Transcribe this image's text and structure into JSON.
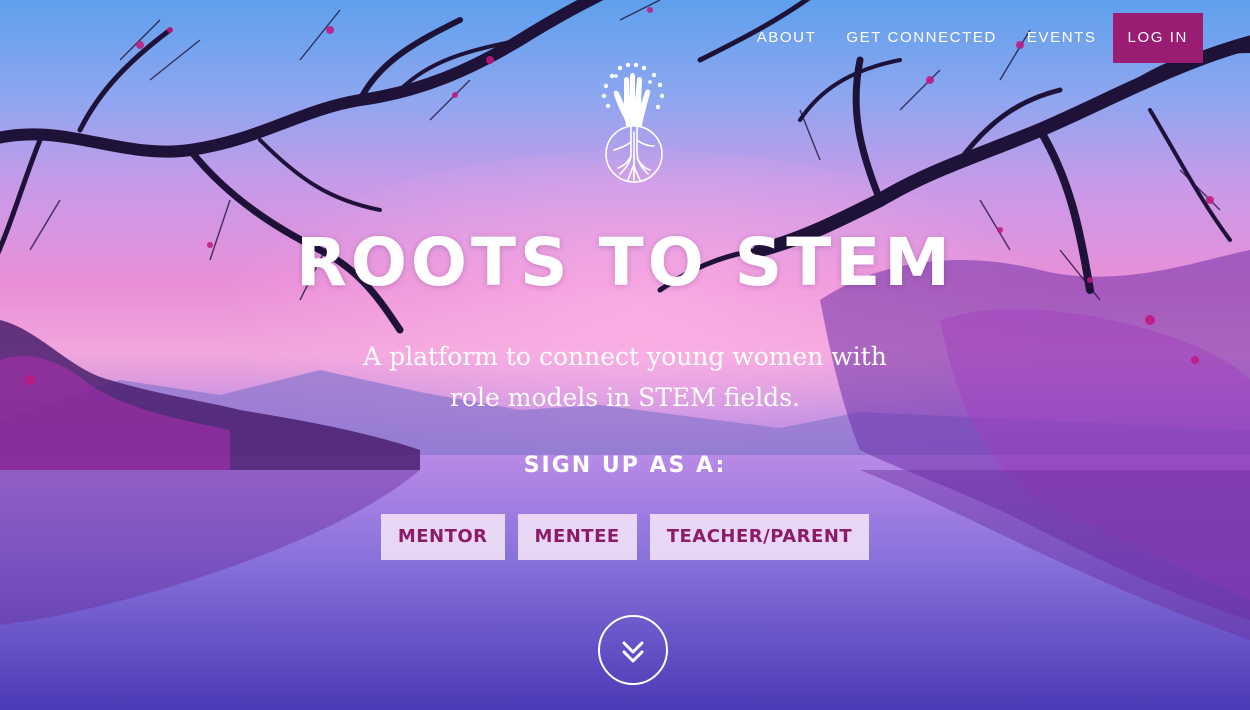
{
  "nav": {
    "items": [
      {
        "label": "ABOUT"
      },
      {
        "label": "GET CONNECTED"
      },
      {
        "label": "EVENTS"
      }
    ],
    "login_label": "LOG IN"
  },
  "hero": {
    "title": "ROOTS TO STEM",
    "subtitle_line1": "A platform to connect young women with",
    "subtitle_line2": "role models in STEM fields.",
    "signup_label": "SIGN UP AS A:",
    "roles": [
      {
        "label": "MENTOR"
      },
      {
        "label": "MENTEE"
      },
      {
        "label": "TEACHER/PARENT"
      }
    ]
  },
  "icons": {
    "logo": "hand-roots-logo-icon",
    "scroll": "double-chevron-down-icon"
  },
  "colors": {
    "accent": "#9b1c73",
    "button_text": "#8d1c68",
    "button_bg": "#f6e6f8"
  }
}
